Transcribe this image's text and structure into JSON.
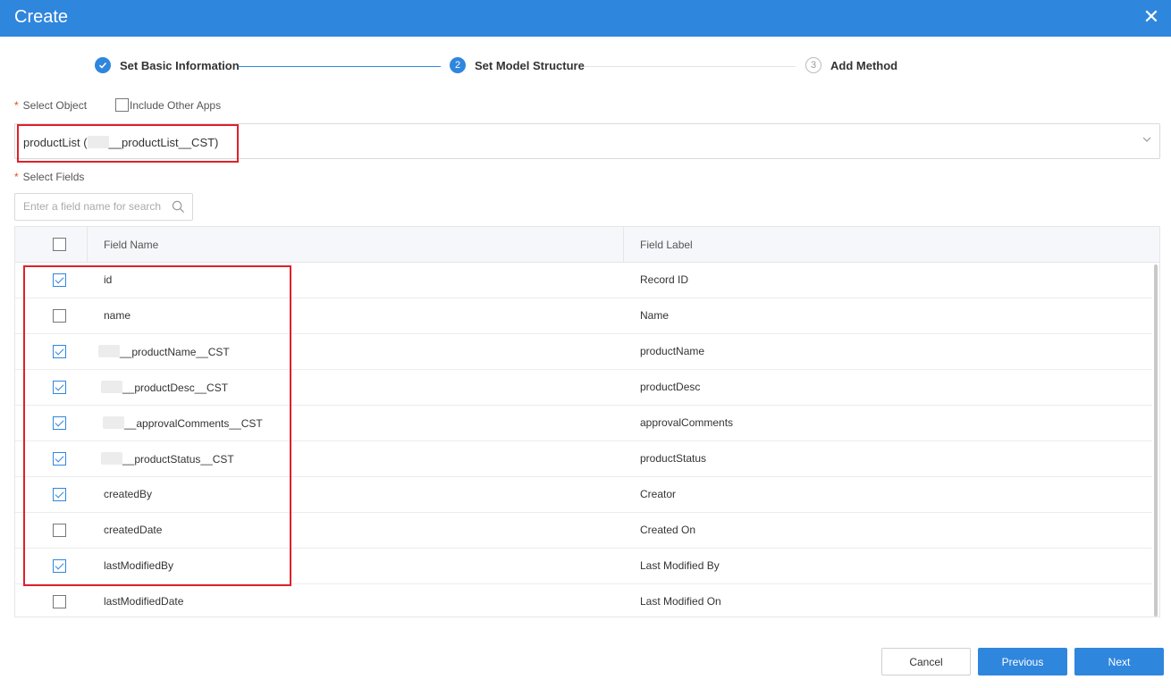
{
  "dialog": {
    "title": "Create",
    "close_icon": "close-icon"
  },
  "steps": [
    {
      "number": "1",
      "label": "Set Basic Information",
      "state": "done"
    },
    {
      "number": "2",
      "label": "Set Model Structure",
      "state": "active"
    },
    {
      "number": "3",
      "label": "Add Method",
      "state": "pending"
    }
  ],
  "select_object": {
    "required_mark": "*",
    "label": "Select Object",
    "include_other_apps": "Include Other Apps",
    "value_prefix": "productList (",
    "value_suffix": "__productList__CST)"
  },
  "select_fields": {
    "required_mark": "*",
    "label": "Select Fields",
    "search_placeholder": "Enter a field name for search"
  },
  "table": {
    "headers": {
      "field_name": "Field Name",
      "field_label": "Field Label"
    },
    "rows": [
      {
        "field_name": "id",
        "field_label": "Record ID",
        "checked": true,
        "masked_prefix": false
      },
      {
        "field_name": "name",
        "field_label": "Name",
        "checked": false,
        "masked_prefix": false
      },
      {
        "field_name": "__productName__CST",
        "field_label": "productName",
        "checked": true,
        "masked_prefix": true
      },
      {
        "field_name": "__productDesc__CST",
        "field_label": "productDesc",
        "checked": true,
        "masked_prefix": true
      },
      {
        "field_name": "__approvalComments__CST",
        "field_label": "approvalComments",
        "checked": true,
        "masked_prefix": true
      },
      {
        "field_name": "__productStatus__CST",
        "field_label": "productStatus",
        "checked": true,
        "masked_prefix": true
      },
      {
        "field_name": "createdBy",
        "field_label": "Creator",
        "checked": true,
        "masked_prefix": false
      },
      {
        "field_name": "createdDate",
        "field_label": "Created On",
        "checked": false,
        "masked_prefix": false
      },
      {
        "field_name": "lastModifiedBy",
        "field_label": "Last Modified By",
        "checked": true,
        "masked_prefix": false
      },
      {
        "field_name": "lastModifiedDate",
        "field_label": "Last Modified On",
        "checked": false,
        "masked_prefix": false
      }
    ]
  },
  "footer": {
    "cancel": "Cancel",
    "previous": "Previous",
    "next": "Next"
  },
  "colors": {
    "primary": "#2f86dd",
    "highlight": "#e0202a",
    "required": "#e84a1c"
  }
}
